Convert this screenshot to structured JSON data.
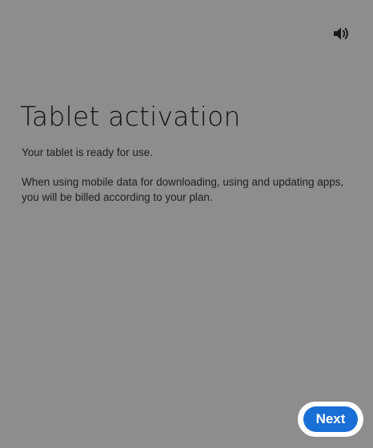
{
  "header": {
    "sound_icon": "speaker-volume-icon"
  },
  "main": {
    "title": "Tablet activation",
    "ready_text": "Your tablet is ready for use.",
    "billing_text": "When using mobile data for downloading, using and updating apps, you will be billed according to your plan."
  },
  "footer": {
    "next_label": "Next"
  },
  "colors": {
    "background": "#8d8d8d",
    "accent": "#1a6fd6",
    "button_highlight": "#ffffff"
  }
}
